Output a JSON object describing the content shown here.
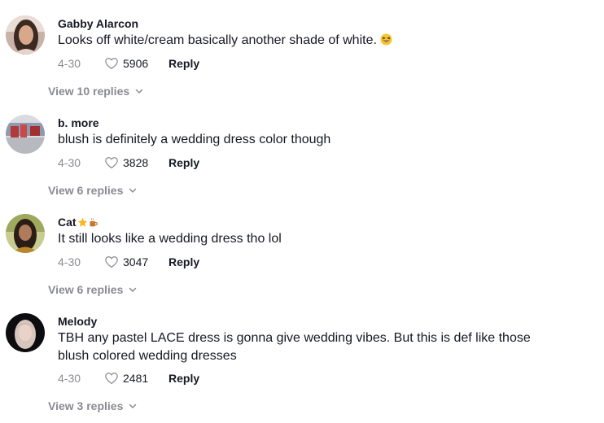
{
  "comments": [
    {
      "username": "Gabby Alarcon",
      "text": "Looks off white/cream basically another shade of white.",
      "inline_emoji": "grinning-squinting-face",
      "date": "4-30",
      "likes": "5906",
      "reply_label": "Reply",
      "view_replies": "View 10 replies"
    },
    {
      "username": "b. more",
      "text": "blush is definitely a wedding dress color though",
      "date": "4-30",
      "likes": "3828",
      "reply_label": "Reply",
      "view_replies": "View 6 replies"
    },
    {
      "username": "Cat",
      "username_emojis": [
        "star-emoji",
        "coffee-emoji"
      ],
      "text": "It still looks like a wedding dress tho lol",
      "date": "4-30",
      "likes": "3047",
      "reply_label": "Reply",
      "view_replies": "View 6 replies"
    },
    {
      "username": "Melody",
      "text_line1": "TBH any pastel LACE dress is gonna give wedding vibes. But this is def like those",
      "text_line2": "blush colored wedding dresses",
      "date": "4-30",
      "likes": "2481",
      "reply_label": "Reply",
      "view_replies": "View 3 replies"
    }
  ],
  "colors": {
    "text": "#161823",
    "muted": "#8a8b91"
  }
}
